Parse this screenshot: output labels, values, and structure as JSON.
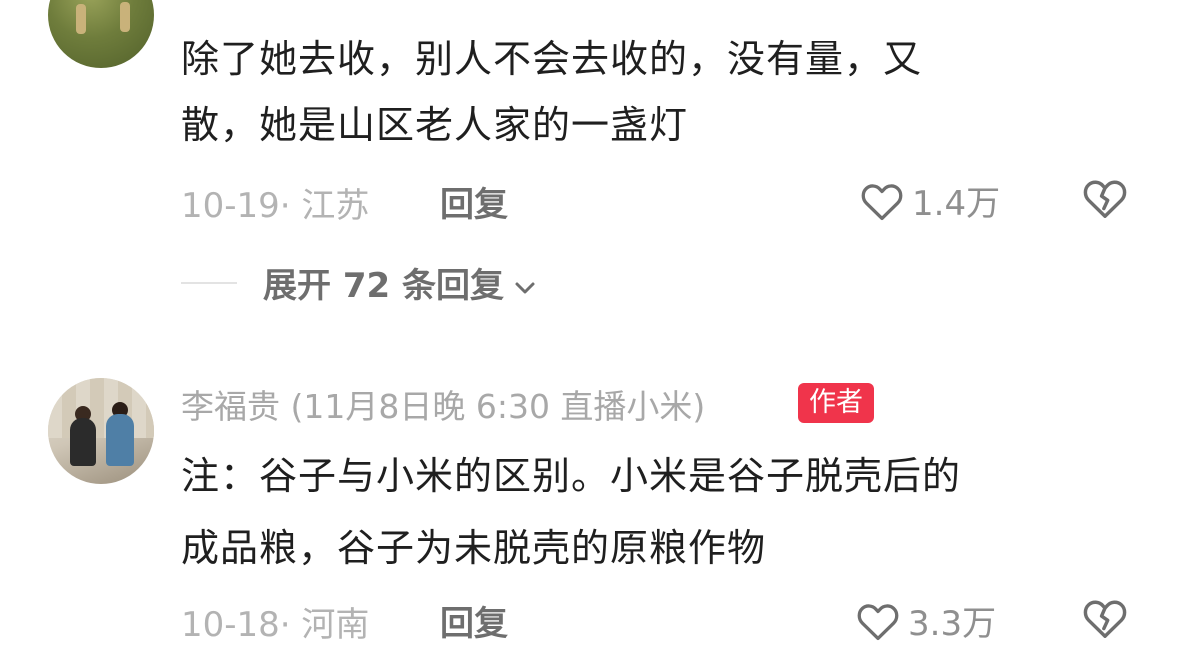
{
  "comments": [
    {
      "lines": [
        "除了她去收，别人不会去收的，没有量，又",
        "散，她是山区老人家的一盏灯"
      ],
      "date_location": "10-19· 江苏",
      "reply_label": "回复",
      "likes": "1.4万",
      "expand_replies": "展开 72 条回复"
    },
    {
      "username": "李福贵 (11月8日晚 6:30 直播小米)",
      "badge": "作者",
      "lines": [
        "注：谷子与小米的区别。小米是谷子脱壳后的",
        "成品粮，谷子为未脱壳的原粮作物"
      ],
      "date_location": "10-18· 河南",
      "reply_label": "回复",
      "likes": "3.3万"
    }
  ],
  "colors": {
    "badge": "#f0344b",
    "text": "#1f1f1f",
    "meta": "#b3b3b3"
  },
  "icons": {
    "like": "heart-outline-icon",
    "dislike": "broken-heart-icon",
    "expand": "chevron-down-icon"
  }
}
